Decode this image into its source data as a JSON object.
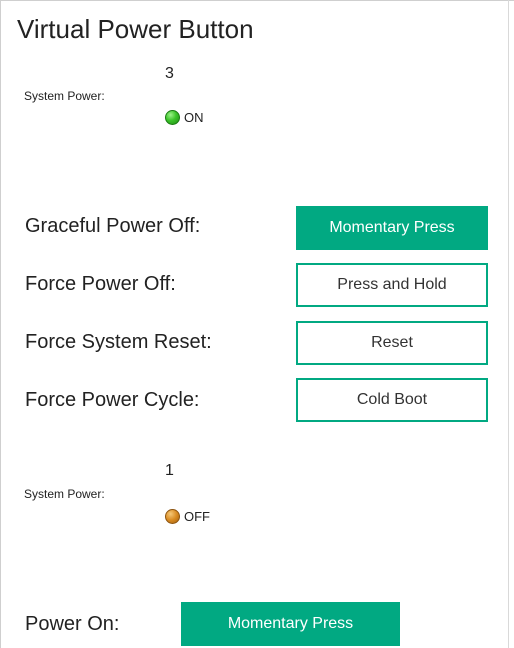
{
  "panel": {
    "title": "Virtual Power Button"
  },
  "server_status": {
    "count": "3",
    "label": "System Power:",
    "state": "ON",
    "indicator_color": "#3cc42a"
  },
  "actions": {
    "graceful_label": "Graceful Power Off:",
    "graceful_button": "Momentary Press",
    "force_off_label": "Force Power Off:",
    "force_off_button": "Press and Hold",
    "reset_label": "Force System Reset:",
    "reset_button": "Reset",
    "cycle_label": "Force Power Cycle:",
    "cycle_button": "Cold Boot"
  },
  "offline_status": {
    "count": "1",
    "label": "System Power:",
    "state": "OFF",
    "indicator_color": "#d98b22"
  },
  "power_on": {
    "label": "Power On:",
    "button": "Momentary Press"
  },
  "colors": {
    "accent": "#01a982"
  }
}
